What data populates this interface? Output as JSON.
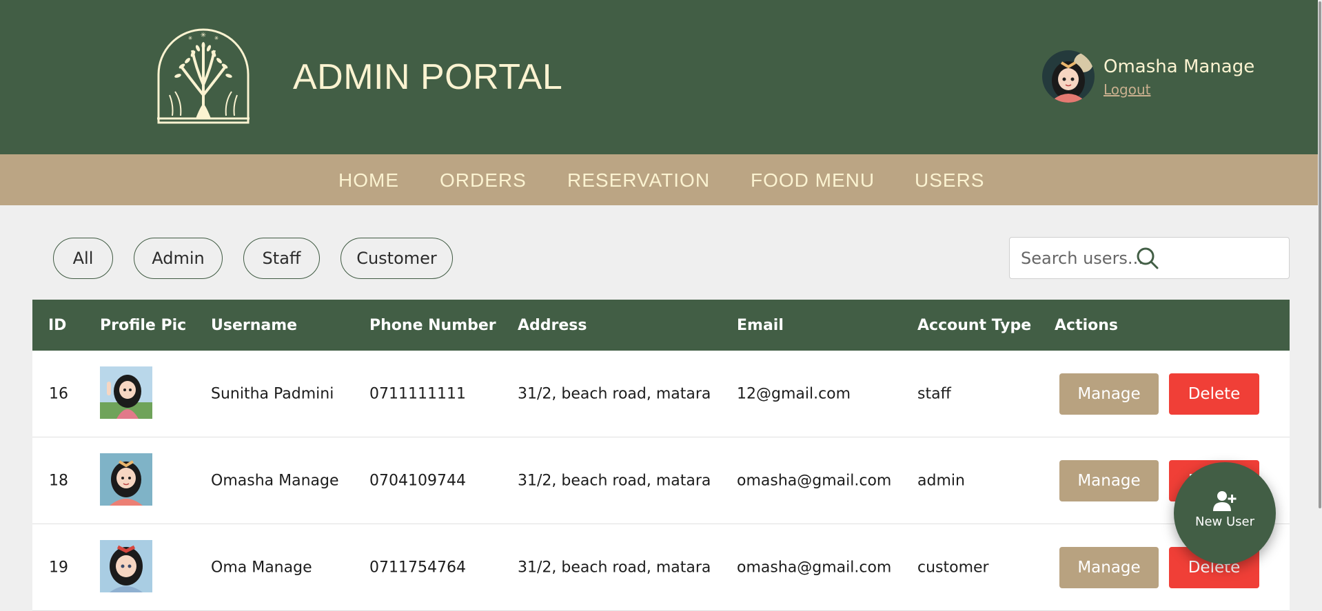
{
  "header": {
    "title": "ADMIN PORTAL",
    "user_name": "Omasha Manage",
    "logout_label": "Logout"
  },
  "nav": {
    "items": [
      "HOME",
      "ORDERS",
      "RESERVATION",
      "FOOD MENU",
      "USERS"
    ]
  },
  "filters": {
    "items": [
      "All",
      "Admin",
      "Staff",
      "Customer"
    ]
  },
  "search": {
    "placeholder": "Search users...",
    "value": ""
  },
  "table": {
    "headers": [
      "ID",
      "Profile Pic",
      "Username",
      "Phone Number",
      "Address",
      "Email",
      "Account Type",
      "Actions"
    ],
    "rows": [
      {
        "id": "16",
        "username": "Sunitha Padmini",
        "phone": "0711111111",
        "address": "31/2, beach road, matara",
        "email": "12@gmail.com",
        "account_type": "staff",
        "manage": "Manage",
        "delete": "Delete"
      },
      {
        "id": "18",
        "username": "Omasha Manage",
        "phone": "0704109744",
        "address": "31/2, beach road, matara",
        "email": "omasha@gmail.com",
        "account_type": "admin",
        "manage": "Manage",
        "delete": "Delete"
      },
      {
        "id": "19",
        "username": "Oma Manage",
        "phone": "0711754764",
        "address": "31/2, beach road, matara",
        "email": "omasha@gmail.com",
        "account_type": "customer",
        "manage": "Manage",
        "delete": "Delete"
      }
    ]
  },
  "fab": {
    "label": "New User",
    "icon": "add-user-icon"
  },
  "colors": {
    "header_bg": "#425e45",
    "nav_bg": "#bba584",
    "manage_btn": "#b8a280",
    "delete_btn": "#f03f37",
    "title_text": "#fbf3d1"
  }
}
